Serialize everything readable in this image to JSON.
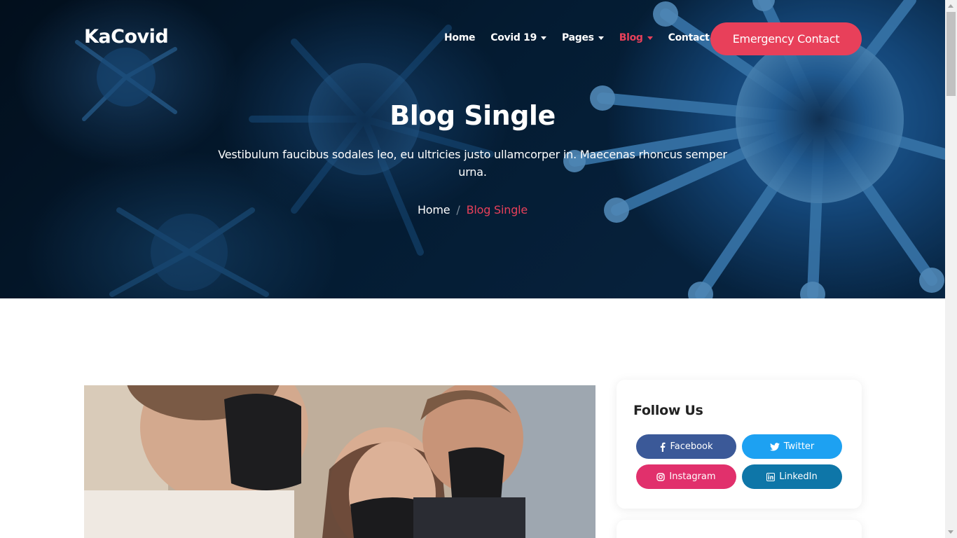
{
  "brand": {
    "logo": "KaCovid"
  },
  "nav": {
    "items": [
      {
        "label": "Home",
        "dropdown": false,
        "active": false
      },
      {
        "label": "Covid 19",
        "dropdown": true,
        "active": false
      },
      {
        "label": "Pages",
        "dropdown": true,
        "active": false
      },
      {
        "label": "Blog",
        "dropdown": true,
        "active": true
      },
      {
        "label": "Contact",
        "dropdown": false,
        "active": false
      }
    ],
    "cta": "Emergency Contact"
  },
  "hero": {
    "title": "Blog Single",
    "subtitle": "Vestibulum faucibus sodales leo, eu ultricies justo ullamcorper in. Maecenas rhoncus semper urna.",
    "breadcrumb": {
      "home": "Home",
      "separator": "/",
      "current": "Blog Single"
    }
  },
  "sidebar": {
    "follow_us": {
      "title": "Follow Us",
      "buttons": [
        {
          "label": "Facebook",
          "icon": "facebook-icon",
          "color": "#3b5998"
        },
        {
          "label": "Twitter",
          "icon": "twitter-icon",
          "color": "#1da1f2"
        },
        {
          "label": "Instagram",
          "icon": "instagram-icon",
          "color": "#e1306c"
        },
        {
          "label": "LinkedIn",
          "icon": "linkedin-icon",
          "color": "#0e76a8"
        }
      ]
    }
  },
  "colors": {
    "accent": "#e8405a",
    "hero_dark": "#06213b",
    "text_dark": "#222222"
  }
}
